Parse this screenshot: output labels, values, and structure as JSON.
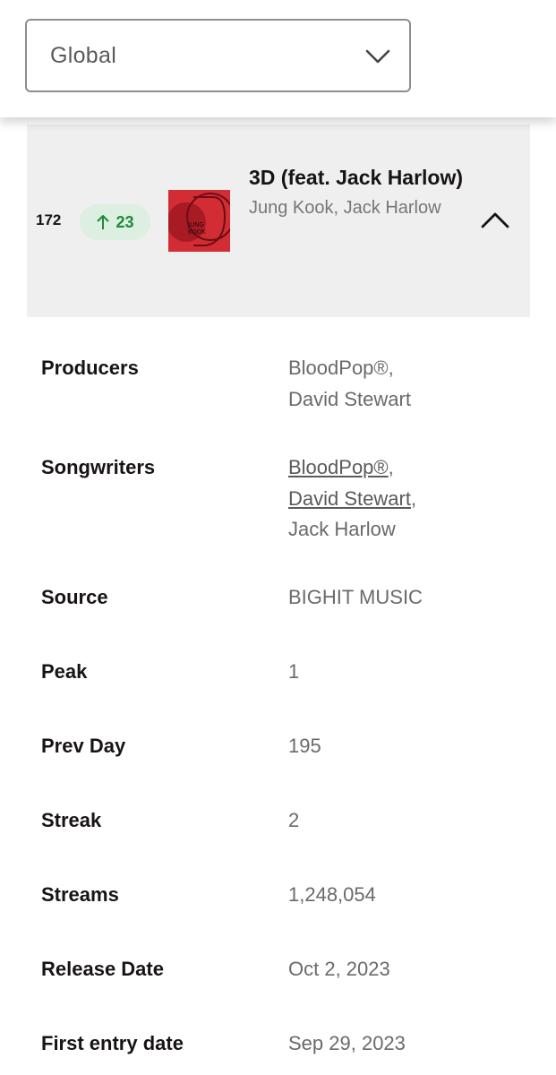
{
  "region_select": {
    "value": "Global"
  },
  "track": {
    "rank": "172",
    "movement": "23",
    "title": "3D (feat. Jack Harlow)",
    "artists": [
      {
        "name": "Jung Kook"
      },
      {
        "name": "Jack Harlow"
      }
    ],
    "cover_lettering": "JUNG KOOK"
  },
  "details": {
    "producers": {
      "label": "Producers",
      "value": [
        "BloodPop®",
        "David Stewart"
      ]
    },
    "songwriters": {
      "label": "Songwriters",
      "value": [
        "BloodPop®",
        "David Stewart",
        "Jack Harlow"
      ]
    },
    "source": {
      "label": "Source",
      "value": "BIGHIT MUSIC"
    },
    "peak": {
      "label": "Peak",
      "value": "1"
    },
    "prev_day": {
      "label": "Prev Day",
      "value": "195"
    },
    "streak": {
      "label": "Streak",
      "value": "2"
    },
    "streams": {
      "label": "Streams",
      "value": "1,248,054"
    },
    "release_date": {
      "label": "Release Date",
      "value": "Oct 2, 2023"
    },
    "first_entry_date": {
      "label": "First entry date",
      "value": "Sep 29, 2023"
    }
  },
  "colors": {
    "movement_up": "#1e8a3a",
    "movement_badge_bg": "#dcefe0",
    "card_bg": "#efefef",
    "cover_red": "#d22c35"
  }
}
